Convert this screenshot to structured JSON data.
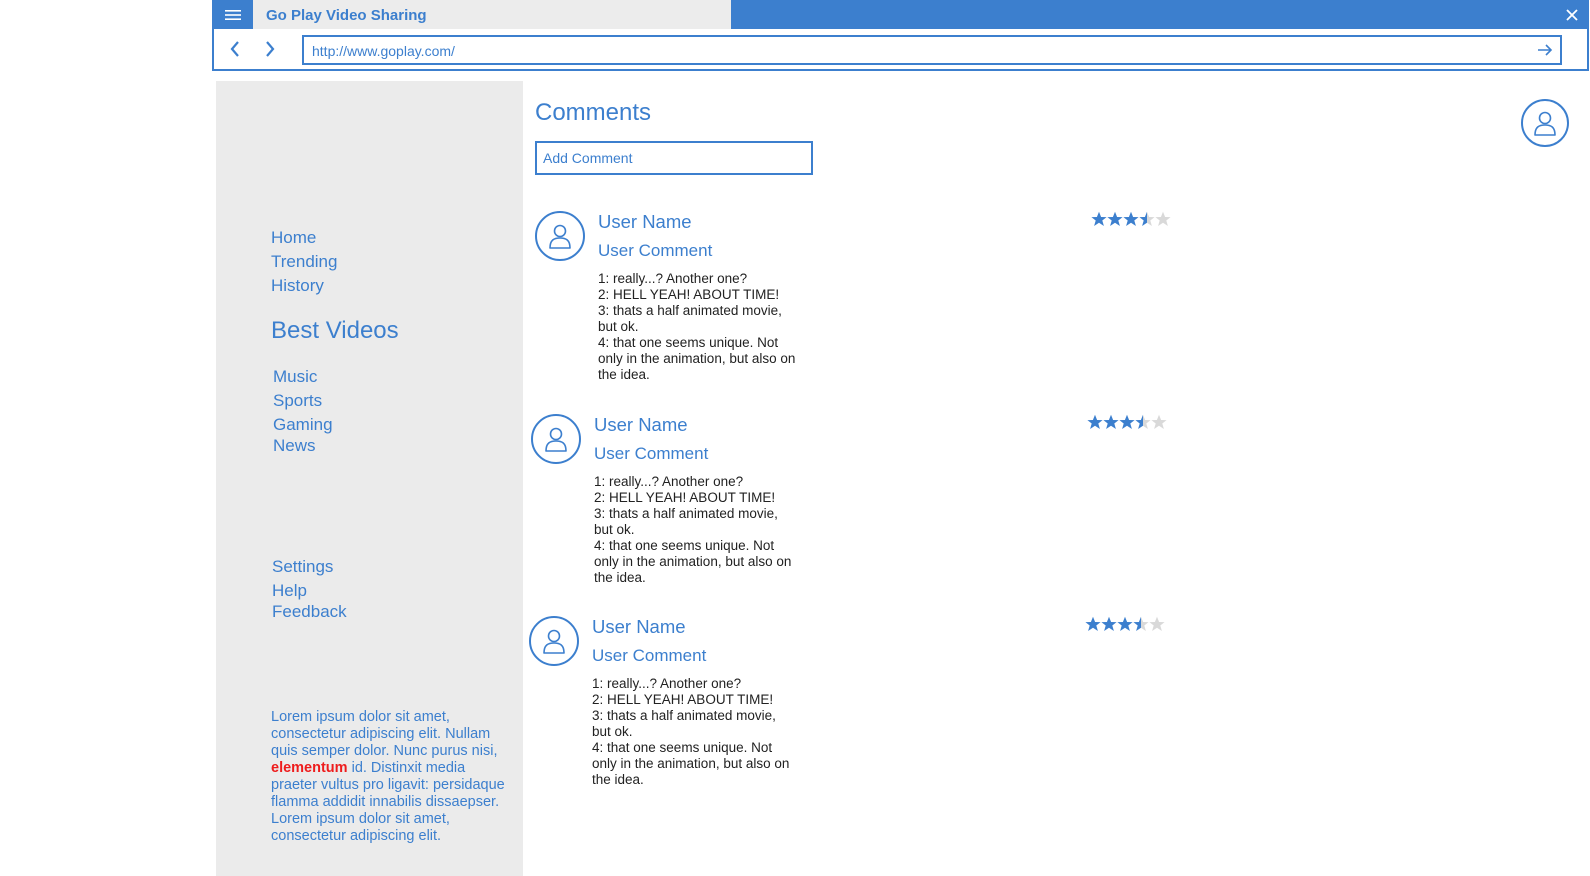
{
  "browser": {
    "tab_title": "Go Play Video Sharing",
    "url": "http://www.goplay.com/"
  },
  "sidebar": {
    "nav": [
      {
        "label": "Home"
      },
      {
        "label": "Trending"
      },
      {
        "label": "History"
      }
    ],
    "section_heading": "Best Videos",
    "categories": [
      {
        "label": "Music"
      },
      {
        "label": "Sports"
      },
      {
        "label": "Gaming"
      },
      {
        "label": "News"
      }
    ],
    "settings_links": [
      {
        "label": "Settings"
      },
      {
        "label": "Help"
      },
      {
        "label": "Feedback"
      }
    ],
    "lorem_before": "Lorem ipsum dolor sit amet, consectetur adipiscing elit. Nullam quis semper dolor. Nunc purus nisi, ",
    "lorem_highlight": "elementum",
    "lorem_after": " id. Distinxit  media praeter vultus pro ligavit: persidaque flamma addidit innabilis dissaepser. Lorem ipsum dolor sit amet, consectetur adipiscing elit."
  },
  "main": {
    "title": "Comments",
    "add_comment_placeholder": "Add Comment",
    "comments": [
      {
        "user_name": "User Name",
        "user_comment": "User Comment",
        "lines": [
          "1: really...? Another one?",
          "2: HELL YEAH! ABOUT TIME!",
          "3: thats a half animated movie, but ok.",
          "4: that one seems unique. Not only in the animation, but also on the idea."
        ],
        "rating": 3.5,
        "rating_max": 5
      },
      {
        "user_name": "User Name",
        "user_comment": "User Comment",
        "lines": [
          "1: really...? Another one?",
          "2: HELL YEAH! ABOUT TIME!",
          "3: thats a half animated movie, but ok.",
          "4: that one seems unique. Not only in the animation, but also on the idea."
        ],
        "rating": 3.5,
        "rating_max": 5
      },
      {
        "user_name": "User Name",
        "user_comment": "User Comment",
        "lines": [
          "1: really...? Another one?",
          "2: HELL YEAH! ABOUT TIME!",
          "3: thats a half animated movie, but ok.",
          "4: that one seems unique. Not only in the animation, but also on the idea."
        ],
        "rating": 3.5,
        "rating_max": 5
      }
    ]
  },
  "colors": {
    "accent": "#3c7fce",
    "sidebar_bg": "#ebebeb",
    "highlight": "#ee1c1c",
    "star_empty": "#d9d9d9"
  },
  "icons": [
    "menu-icon",
    "close-icon",
    "back-arrow-icon",
    "forward-arrow-icon",
    "go-arrow-icon",
    "user-avatar-icon",
    "star-icon"
  ]
}
